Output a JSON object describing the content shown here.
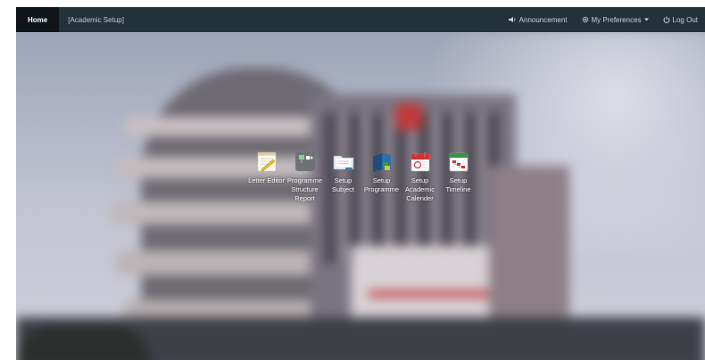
{
  "navbar": {
    "home_label": "Home",
    "breadcrumb": "[Academic Setup]",
    "announcement_label": "Announcement",
    "preferences_label": "My Preferences",
    "logout_label": "Log Out"
  },
  "apps": [
    {
      "label": "Letter Editor",
      "icon": "letter-editor-icon"
    },
    {
      "label": "Programme Structure Report",
      "icon": "structure-report-icon"
    },
    {
      "label": "Setup Subject",
      "icon": "subject-folder-icon"
    },
    {
      "label": "Setup Programme",
      "icon": "programme-books-icon"
    },
    {
      "label": "Setup Academic Calender",
      "icon": "calendar-icon"
    },
    {
      "label": "Setup Timeline",
      "icon": "timeline-icon"
    }
  ],
  "colors": {
    "navbar": "#22323b",
    "home_active": "#0e1418",
    "background_sky": "#b2b6c8"
  }
}
